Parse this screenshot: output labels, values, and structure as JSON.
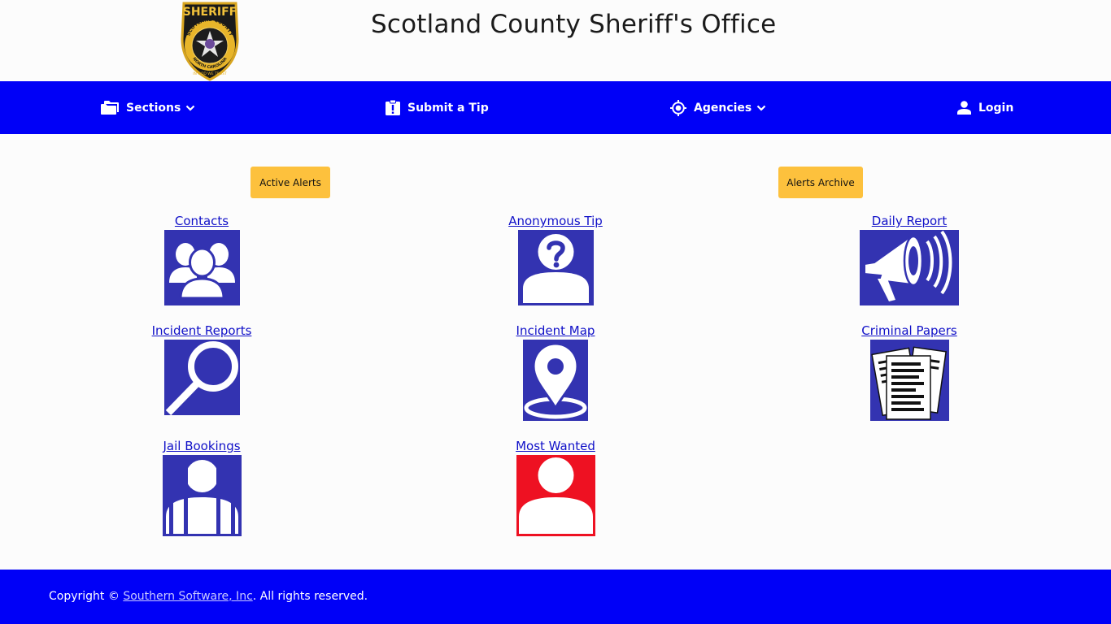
{
  "header": {
    "title": "Scotland County Sheriff's Office",
    "logo": {
      "top_text": "SHERIFF",
      "ring_text": "SCOTLAND COUNTY",
      "bottom_text": "NORTH CAROLINA",
      "motto": "IN GOD WE TRUST",
      "icon": "sheriff-badge-icon"
    }
  },
  "nav": {
    "sections": {
      "label": "Sections",
      "icon": "folder-icon"
    },
    "tip": {
      "label": "Submit a Tip",
      "icon": "clipboard-alert-icon"
    },
    "agencies": {
      "label": "Agencies",
      "icon": "crosshair-icon"
    },
    "login": {
      "label": "Login",
      "icon": "user-icon"
    }
  },
  "alerts": {
    "active_label": "Active Alerts",
    "archive_label": "Alerts Archive",
    "color": "#fdc13d"
  },
  "tiles": [
    {
      "label": "Contacts",
      "icon": "contacts-group-icon"
    },
    {
      "label": "Anonymous Tip",
      "icon": "anonymous-person-icon"
    },
    {
      "label": "Daily Report",
      "icon": "megaphone-icon"
    },
    {
      "label": "Incident Reports",
      "icon": "magnifying-glass-icon"
    },
    {
      "label": "Incident Map",
      "icon": "map-pin-icon"
    },
    {
      "label": "Criminal Papers",
      "icon": "documents-icon"
    },
    {
      "label": "Jail Bookings",
      "icon": "jail-bars-icon"
    },
    {
      "label": "Most Wanted",
      "icon": "wanted-person-icon"
    }
  ],
  "footer": {
    "prefix": "Copyright © ",
    "link": "Southern Software, Inc",
    "suffix": ". All rights reserved."
  },
  "colors": {
    "nav_bg": "#0000f7",
    "tile_bg": "#3333b1",
    "wanted_bg": "#ee1122",
    "link": "#1010c8"
  }
}
